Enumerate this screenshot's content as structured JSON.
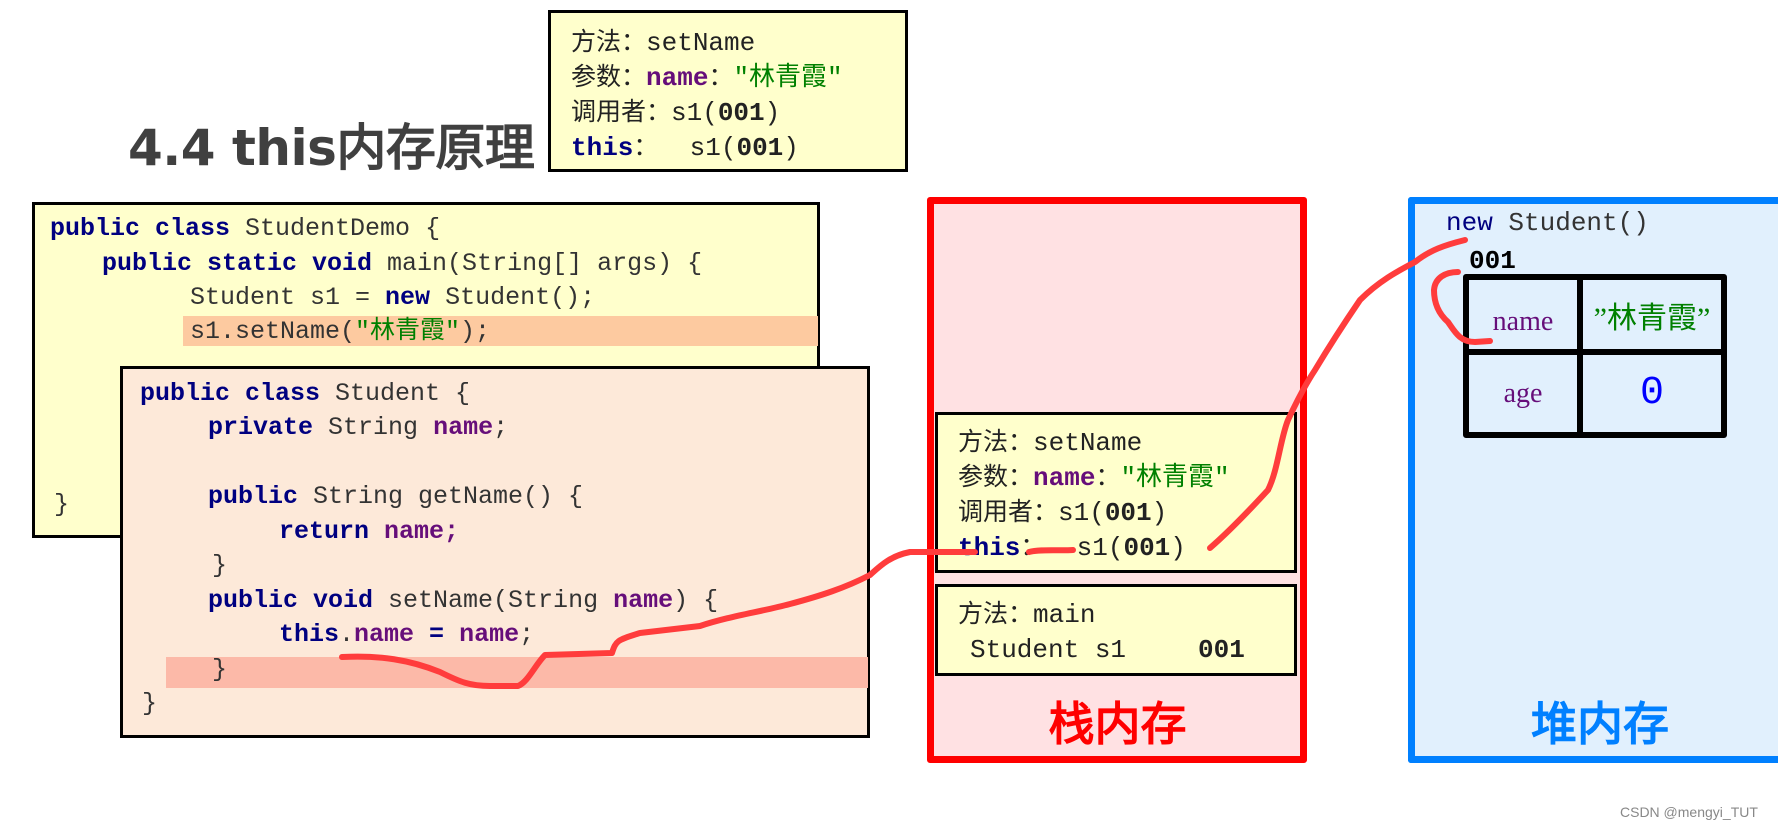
{
  "title": "4.4 this内存原理",
  "top_note": {
    "method_label": "方法：",
    "method_value": "setName",
    "param_label": "参数：",
    "param_name": "name",
    "param_sep": "：",
    "param_value": "\"林青霞\"",
    "caller_label": "调用者：",
    "caller_prefix": "s1(",
    "caller_addr": "001",
    "caller_suffix": ")",
    "this_label": "this",
    "this_sep": "：",
    "this_prefix": "s1(",
    "this_addr": "001",
    "this_suffix": ")"
  },
  "code_outer": {
    "line1": {
      "kw": "public class",
      "rest": " StudentDemo {"
    },
    "line2": {
      "kw": "public static void",
      "rest": " main(String[] args) {"
    },
    "line3": {
      "pre": "Student s1 = ",
      "kw": "new",
      "rest": " Student();"
    },
    "line4": {
      "pre": "s1.setName(",
      "str": "\"林青霞\"",
      "rest": ");"
    },
    "line_close": "}"
  },
  "code_inner": {
    "line1": {
      "kw": "public class",
      "rest": " Student {"
    },
    "line2": {
      "kw": "private",
      "rest": " String ",
      "fld": "name",
      "end": ";"
    },
    "line3": {
      "kw": "public",
      "rest": " String getName() {"
    },
    "line4": {
      "kw": "return",
      "fld": " name",
      "end": ";"
    },
    "line5": "}",
    "line6": {
      "kw": "public void",
      "rest": " setName(String ",
      "fld": "name",
      "end": ") {"
    },
    "line7": {
      "kw": "this",
      "dot": ".",
      "fld": "name",
      "eq": " = ",
      "fld2": "name",
      "end": ";"
    },
    "line8": "}",
    "line9": "}"
  },
  "stack": {
    "label": "栈内存",
    "frame_setname": {
      "method_label": "方法：",
      "method_value": "setName",
      "param_label": "参数：",
      "param_name": "name",
      "param_sep": "：",
      "param_value": "\"林青霞\"",
      "caller_label": "调用者：",
      "caller_prefix": "s1(",
      "caller_addr": "001",
      "caller_suffix": ")",
      "this_label": "this",
      "this_sep": "：",
      "this_prefix": "s1(",
      "this_addr": "001",
      "this_suffix": ")"
    },
    "frame_main": {
      "method_label": "方法：",
      "method_value": "main",
      "var_decl": "Student s1",
      "var_value": "001"
    }
  },
  "heap": {
    "label": "堆内存",
    "new_kw": "new",
    "new_rest": " Student()",
    "address": "001",
    "fields": [
      {
        "name": "name",
        "value": "”林青霞”"
      },
      {
        "name": "age",
        "value": "0"
      }
    ]
  },
  "watermark": "CSDN @mengyi_TUT",
  "colors": {
    "keyword": "#000080",
    "field": "#660e7a",
    "string": "#008000",
    "stack_border": "#ff0000",
    "heap_border": "#0080ff",
    "annotation": "#ff3c3c"
  }
}
